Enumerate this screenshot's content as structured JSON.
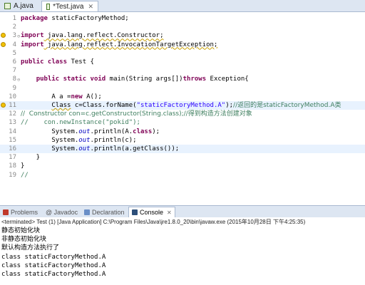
{
  "editor_tabs": [
    {
      "label": "A.java"
    },
    {
      "label": "*Test.java",
      "close": "✕"
    }
  ],
  "code_lines": [
    {
      "n": "1",
      "segs": [
        {
          "t": "package",
          "c": "kw"
        },
        {
          "t": " staticFactoryMethod;"
        }
      ]
    },
    {
      "n": "2",
      "segs": []
    },
    {
      "n": "3",
      "segs": [
        {
          "t": "import",
          "c": "kw"
        },
        {
          "t": " java.lang.reflect.Constructor;",
          "c": "warn-ul"
        }
      ],
      "marker": true,
      "fold": "⊖"
    },
    {
      "n": "4",
      "segs": [
        {
          "t": "import",
          "c": "kw"
        },
        {
          "t": " java.lang.reflect.InvocationTargetException;",
          "c": "warn-ul"
        }
      ],
      "marker": true
    },
    {
      "n": "5",
      "segs": []
    },
    {
      "n": "6",
      "segs": [
        {
          "t": "public class",
          "c": "kw"
        },
        {
          "t": " Test {"
        }
      ]
    },
    {
      "n": "7",
      "segs": []
    },
    {
      "n": "8",
      "segs": [
        {
          "t": "    "
        },
        {
          "t": "public static void",
          "c": "kw"
        },
        {
          "t": " main(String args[])"
        },
        {
          "t": "throws",
          "c": "kw"
        },
        {
          "t": " Exception{"
        }
      ],
      "fold": "⊖"
    },
    {
      "n": "9",
      "segs": []
    },
    {
      "n": "10",
      "segs": [
        {
          "t": "        A a ="
        },
        {
          "t": "new",
          "c": "kw"
        },
        {
          "t": " A();"
        }
      ]
    },
    {
      "n": "11",
      "segs": [
        {
          "t": "        "
        },
        {
          "t": "Class",
          "c": "warn-ul"
        },
        {
          "t": " c=Class.forName("
        },
        {
          "t": "\"staticFactoryMethod.A\"",
          "c": "str"
        },
        {
          "t": ");"
        },
        {
          "t": "//返回的是staticFactoryMethod.A类",
          "c": "cmt"
        }
      ],
      "marker": true,
      "hl": true
    },
    {
      "n": "12",
      "segs": [
        {
          "t": "//  Constructor con=c.getConstructor(String.class);//得到构造方法创建对象",
          "c": "cmt"
        }
      ]
    },
    {
      "n": "13",
      "segs": [
        {
          "t": "//    con.newInstance(\"pokid\");",
          "c": "cmt"
        }
      ]
    },
    {
      "n": "14",
      "segs": [
        {
          "t": "        System."
        },
        {
          "t": "out",
          "c": "fld"
        },
        {
          "t": ".println(A."
        },
        {
          "t": "class",
          "c": "kw"
        },
        {
          "t": ");"
        }
      ]
    },
    {
      "n": "15",
      "segs": [
        {
          "t": "        System."
        },
        {
          "t": "out",
          "c": "fld"
        },
        {
          "t": ".println(c);"
        }
      ]
    },
    {
      "n": "16",
      "segs": [
        {
          "t": "        System."
        },
        {
          "t": "out",
          "c": "fld"
        },
        {
          "t": ".println(a.getClass());"
        }
      ],
      "hl": true
    },
    {
      "n": "17",
      "segs": [
        {
          "t": "    }"
        }
      ]
    },
    {
      "n": "18",
      "segs": [
        {
          "t": "}"
        }
      ]
    },
    {
      "n": "19",
      "segs": [
        {
          "t": "//",
          "c": "cmt"
        }
      ]
    }
  ],
  "view_tabs": [
    {
      "label": "Problems",
      "color": "#c0392b"
    },
    {
      "label": "@ Javadoc",
      "color": "#777777"
    },
    {
      "label": "Declaration",
      "color": "#6a8fc7"
    },
    {
      "label": "Console",
      "color": "#2d4f7a",
      "active": true,
      "close": "✕"
    }
  ],
  "console": {
    "terminated": "<terminated> Test (1) [Java Application] C:\\Program Files\\Java\\jre1.8.0_20\\bin\\javaw.exe (2015年10月28日 下午4:25:35)",
    "output": [
      "静态初始化块",
      "非静态初始化块",
      "默认构造方法执行了",
      "class staticFactoryMethod.A",
      "class staticFactoryMethod.A",
      "class staticFactoryMethod.A"
    ]
  }
}
